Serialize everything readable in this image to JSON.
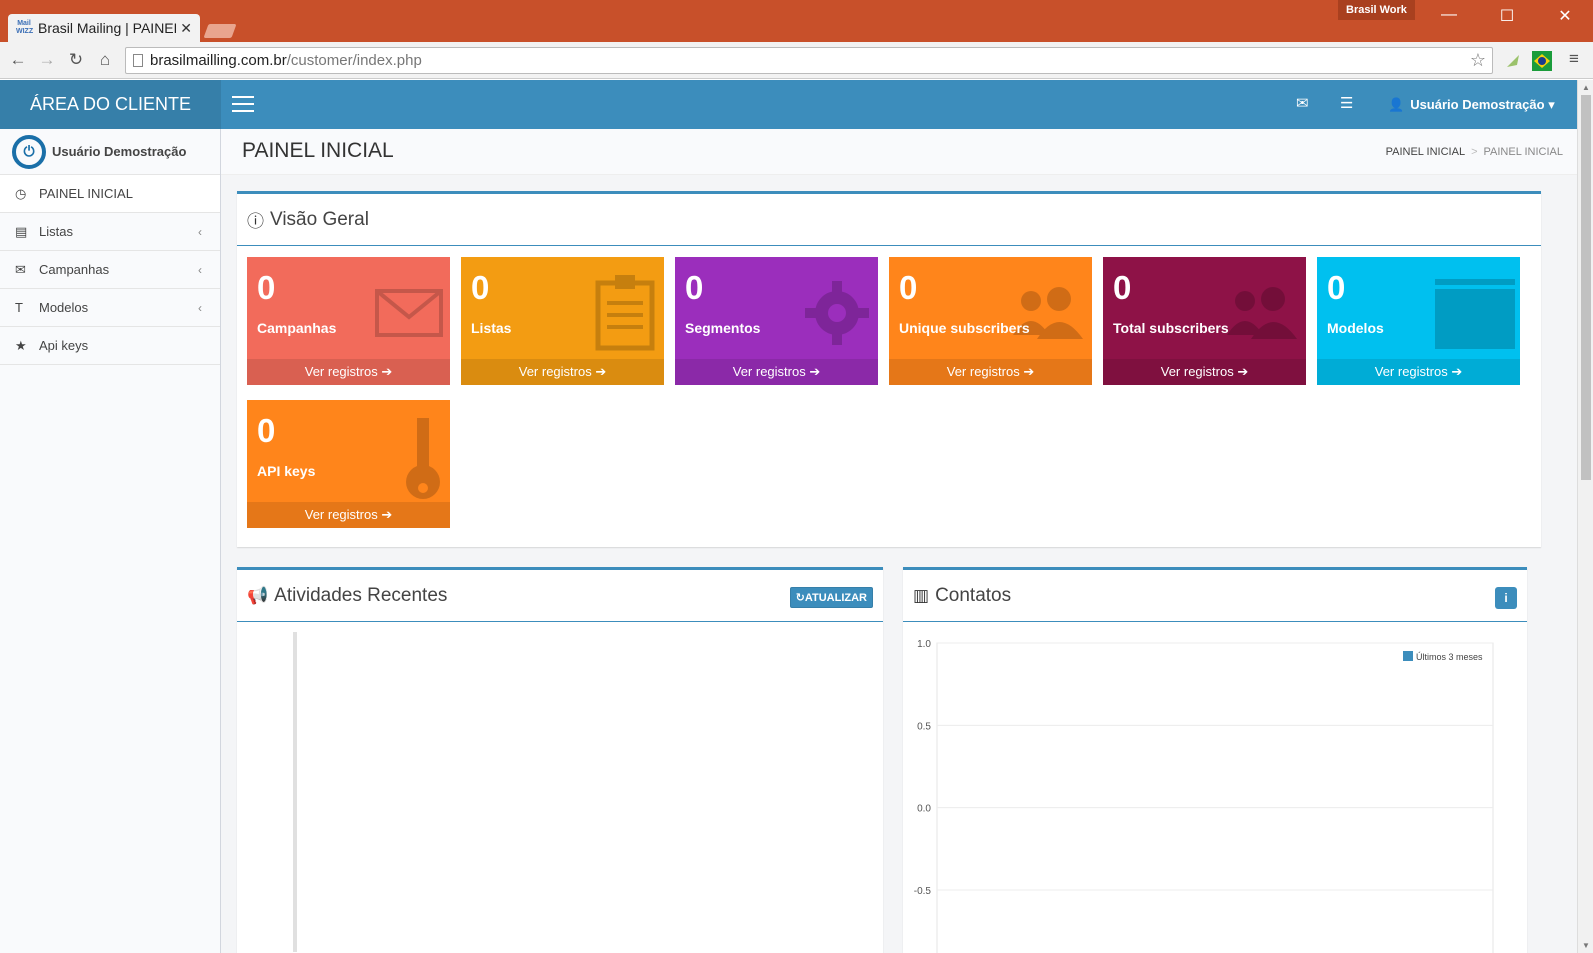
{
  "browser": {
    "tab_title": "Brasil Mailing | PAINEL INICIAL",
    "favicon_text": "Mail WIZZ",
    "profile_name": "Brasil Work",
    "url_domain": "brasilmailling.com.br",
    "url_path": "/customer/index.php"
  },
  "header": {
    "brand": "ÁREA DO CLIENTE",
    "user_name": "Usuário Demostração",
    "accent_color": "#3c8dbc"
  },
  "sidebar": {
    "user_name": "Usuário Demostração",
    "items": [
      {
        "label": "PAINEL INICIAL",
        "icon": "dashboard-icon"
      },
      {
        "label": "Listas",
        "icon": "list-icon"
      },
      {
        "label": "Campanhas",
        "icon": "envelope-icon"
      },
      {
        "label": "Modelos",
        "icon": "text-icon"
      },
      {
        "label": "Api keys",
        "icon": "star-icon"
      }
    ]
  },
  "content": {
    "page_title": "PAINEL INICIAL",
    "breadcrumb": [
      "PAINEL INICIAL",
      "PAINEL INICIAL"
    ]
  },
  "overview": {
    "title": "Visão Geral",
    "footer_label": "Ver registros",
    "tiles": [
      {
        "value": "0",
        "label": "Campanhas",
        "color": "#f26b5b",
        "icon": "envelope-icon"
      },
      {
        "value": "0",
        "label": "Listas",
        "color": "#f39c12",
        "icon": "clipboard-icon"
      },
      {
        "value": "0",
        "label": "Segmentos",
        "color": "#9b2ebc",
        "icon": "gear-icon"
      },
      {
        "value": "0",
        "label": "Unique subscribers",
        "color": "#ff851b",
        "icon": "users-icon"
      },
      {
        "value": "0",
        "label": "Total subscribers",
        "color": "#8e1247",
        "icon": "users-icon"
      },
      {
        "value": "0",
        "label": "Modelos",
        "color": "#00c0ef",
        "icon": "window-icon"
      },
      {
        "value": "0",
        "label": "API keys",
        "color": "#ff851b",
        "icon": "key-icon"
      }
    ]
  },
  "activities": {
    "title": "Atividades Recentes",
    "refresh_label": "ATUALIZAR"
  },
  "contacts": {
    "title": "Contatos"
  },
  "chart_data": {
    "type": "line",
    "series": [
      {
        "name": "Últimos 3 meses",
        "values": []
      }
    ],
    "yticks": [
      "1.0",
      "0.5",
      "0.0",
      "-0.5"
    ],
    "ylim": [
      -0.5,
      1.0
    ],
    "grid": true,
    "legend": "top-right",
    "legend_color": "#3c8dbc"
  }
}
